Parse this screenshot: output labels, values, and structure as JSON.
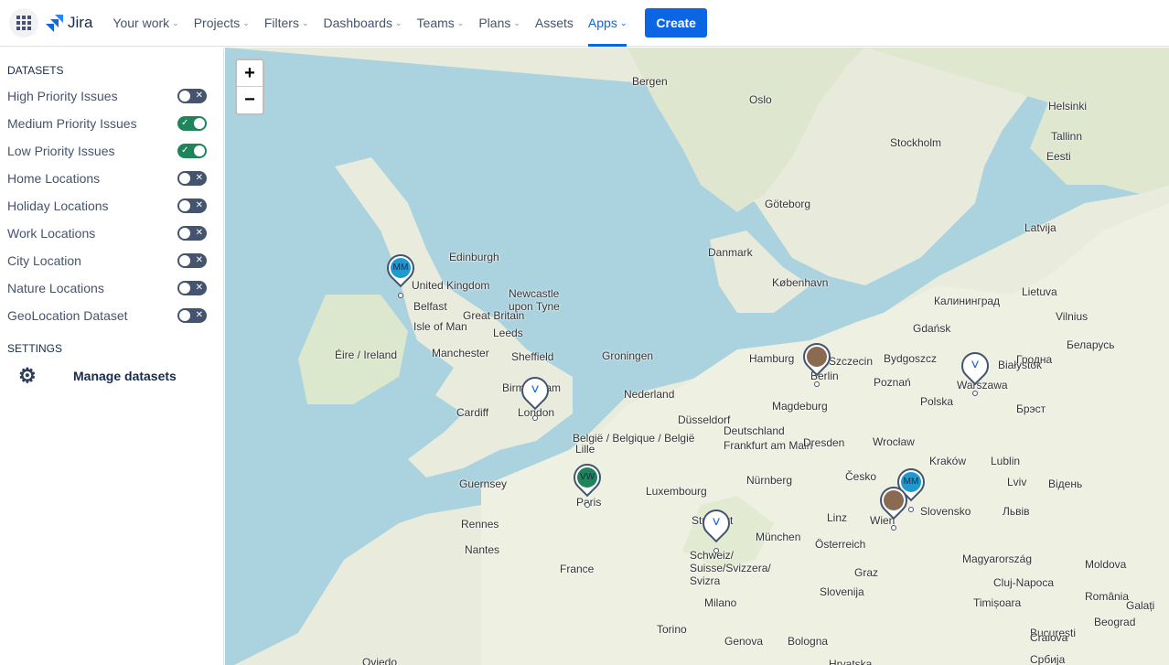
{
  "topbar": {
    "product": "Jira",
    "nav": [
      "Your work",
      "Projects",
      "Filters",
      "Dashboards",
      "Teams",
      "Plans",
      "Assets",
      "Apps"
    ],
    "active": "Apps",
    "create": "Create"
  },
  "sidebar": {
    "datasets_heading": "DATASETS",
    "datasets": [
      {
        "label": "High Priority Issues",
        "on": false
      },
      {
        "label": "Medium Priority Issues",
        "on": true
      },
      {
        "label": "Low Priority Issues",
        "on": true
      },
      {
        "label": "Home Locations",
        "on": false
      },
      {
        "label": "Holiday Locations",
        "on": false
      },
      {
        "label": "Work Locations",
        "on": false
      },
      {
        "label": "City Location",
        "on": false
      },
      {
        "label": "Nature Locations",
        "on": false
      },
      {
        "label": "GeoLocation Dataset",
        "on": false
      }
    ],
    "settings_heading": "SETTINGS",
    "manage": "Manage datasets"
  },
  "map": {
    "zoom_in": "+",
    "zoom_out": "−",
    "labels": [
      "Bergen",
      "Oslo",
      "Stockholm",
      "Helsinki",
      "Tallinn",
      "Eesti",
      "Göteborg",
      "Latvija",
      "Danmark",
      "København",
      "Edinburgh",
      "United Kingdom",
      "Newcastle upon Tyne",
      "Great Britain",
      "Belfast",
      "Isle of Man",
      "Éire / Ireland",
      "Manchester",
      "Leeds",
      "Sheffield",
      "Birmingham",
      "Cardiff",
      "London",
      "Lietuva",
      "Vilnius",
      "Gdańsk",
      "Hamburg",
      "Szczecin",
      "Bydgoszcz",
      "Groningen",
      "Nederland",
      "Berlin",
      "Poznań",
      "Polska",
      "Warszawa",
      "Białystok",
      "Беларусь",
      "Magdeburg",
      "Deutschland",
      "Düsseldorf",
      "Lille",
      "België / Belgique / België",
      "Frankfurt am Main",
      "Dresden",
      "Wrocław",
      "Kraków",
      "Lublin",
      "Guernsey",
      "Paris",
      "Luxembourg",
      "Nürnberg",
      "Česko",
      "Rennes",
      "Nantes",
      "Stuttgart",
      "München",
      "Linz",
      "Wien",
      "Slovensko",
      "France",
      "Schweiz/ Suisse/Svizzera/ Svizra",
      "Österreich",
      "Graz",
      "Magyarország",
      "Milano",
      "Slovenija",
      "Torino",
      "Genova",
      "Bologna",
      "Hrvatska",
      "România",
      "Moldova",
      "Cluj-Napoca",
      "Timișoara",
      "Beograd",
      "Србија",
      "București",
      "Craiova",
      "Galați",
      "Oviedo",
      "Калининград",
      "Брэст",
      "Гродна",
      "Lviv",
      "Львів",
      "Відень"
    ],
    "markers": [
      {
        "type": "avatar",
        "initials": "MM",
        "color": "#1d9bd1"
      },
      {
        "type": "chevron",
        "initials": "˅",
        "color": "#ffffff"
      },
      {
        "type": "avatar",
        "initials": "VW",
        "color": "#1f845a"
      },
      {
        "type": "photo",
        "initials": "",
        "color": "#8a6a50"
      },
      {
        "type": "chevron",
        "initials": "˅",
        "color": "#ffffff"
      },
      {
        "type": "avatar",
        "initials": "MM",
        "color": "#1d9bd1"
      },
      {
        "type": "photo",
        "initials": "",
        "color": "#8a6a50"
      },
      {
        "type": "chevron",
        "initials": "˅",
        "color": "#ffffff"
      }
    ]
  }
}
